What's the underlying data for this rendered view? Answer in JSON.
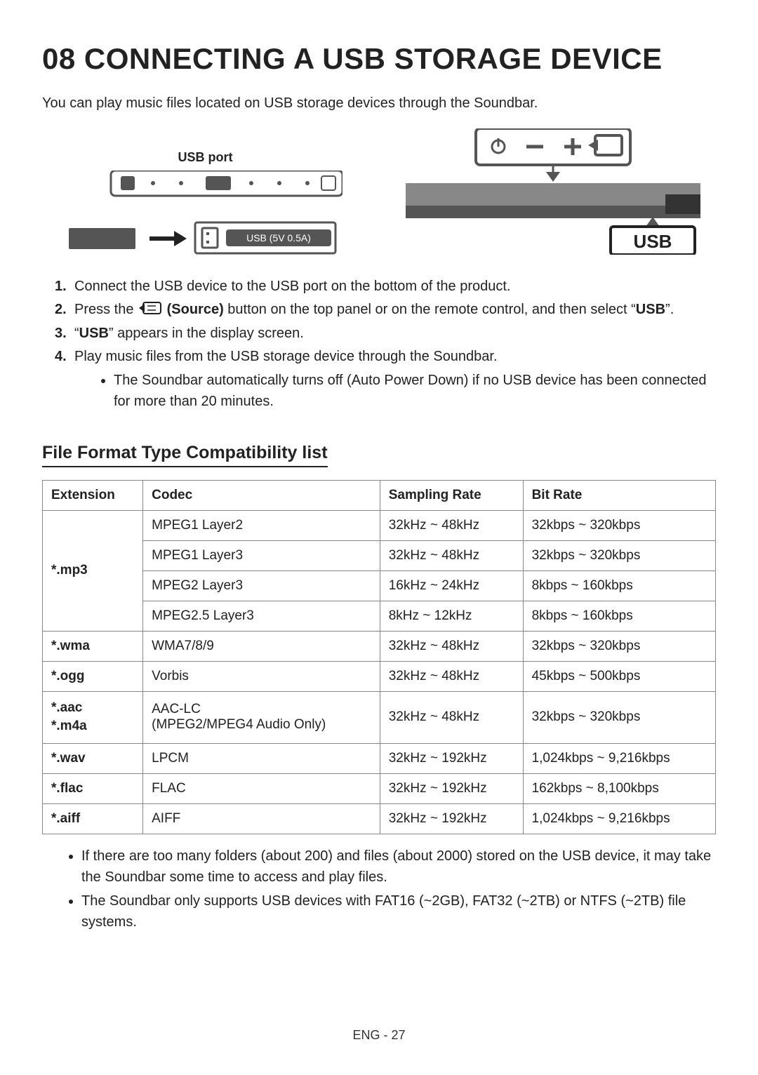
{
  "title": "08 CONNECTING A USB STORAGE DEVICE",
  "intro": "You can play music files located on USB storage devices through the Soundbar.",
  "diagram": {
    "usb_port_label": "USB port",
    "usb_port_box_label": "USB (5V 0.5A)",
    "display_label": "USB"
  },
  "steps": [
    "Connect the USB device to the USB port on the bottom of the product.",
    {
      "prefix": "Press the ",
      "strong": "(Source)",
      "mid": " button on the top panel or on the remote control, and then select “",
      "strong2": "USB",
      "suffix": "”."
    },
    {
      "open": "“",
      "strong": "USB",
      "close": "” appears in the display screen."
    },
    "Play music files from the USB storage device through the Soundbar."
  ],
  "substeps": [
    "The Soundbar automatically turns off (Auto Power Down) if no USB device has been connected for more than 20 minutes."
  ],
  "section_title": "File Format Type Compatibility list",
  "table": {
    "headers": [
      "Extension",
      "Codec",
      "Sampling Rate",
      "Bit Rate"
    ],
    "rows": [
      {
        "ext": "*.mp3",
        "codec": "MPEG1 Layer2",
        "rate": "32kHz ~ 48kHz",
        "bit": "32kbps ~ 320kbps",
        "span": 4
      },
      {
        "codec": "MPEG1 Layer3",
        "rate": "32kHz ~ 48kHz",
        "bit": "32kbps ~ 320kbps"
      },
      {
        "codec": "MPEG2 Layer3",
        "rate": "16kHz ~ 24kHz",
        "bit": "8kbps ~ 160kbps"
      },
      {
        "codec": "MPEG2.5 Layer3",
        "rate": "8kHz ~ 12kHz",
        "bit": "8kbps ~ 160kbps"
      },
      {
        "ext": "*.wma",
        "codec": "WMA7/8/9",
        "rate": "32kHz ~ 48kHz",
        "bit": "32kbps ~ 320kbps"
      },
      {
        "ext": "*.ogg",
        "codec": "Vorbis",
        "rate": "32kHz ~ 48kHz",
        "bit": "45kbps ~ 500kbps"
      },
      {
        "ext": "*.aac\n*.m4a",
        "codec": "AAC-LC\n(MPEG2/MPEG4 Audio Only)",
        "rate": "32kHz ~ 48kHz",
        "bit": "32kbps ~ 320kbps"
      },
      {
        "ext": "*.wav",
        "codec": "LPCM",
        "rate": "32kHz ~ 192kHz",
        "bit": "1,024kbps ~ 9,216kbps"
      },
      {
        "ext": "*.flac",
        "codec": "FLAC",
        "rate": "32kHz ~ 192kHz",
        "bit": "162kbps ~ 8,100kbps"
      },
      {
        "ext": "*.aiff",
        "codec": "AIFF",
        "rate": "32kHz ~ 192kHz",
        "bit": "1,024kbps ~ 9,216kbps"
      }
    ]
  },
  "notes": [
    "If there are too many folders (about 200) and files (about 2000) stored on the USB device, it may take the Soundbar some time to access and play files.",
    "The Soundbar only supports USB devices with FAT16 (~2GB), FAT32 (~2TB) or NTFS (~2TB) file systems."
  ],
  "footer": "ENG - 27"
}
